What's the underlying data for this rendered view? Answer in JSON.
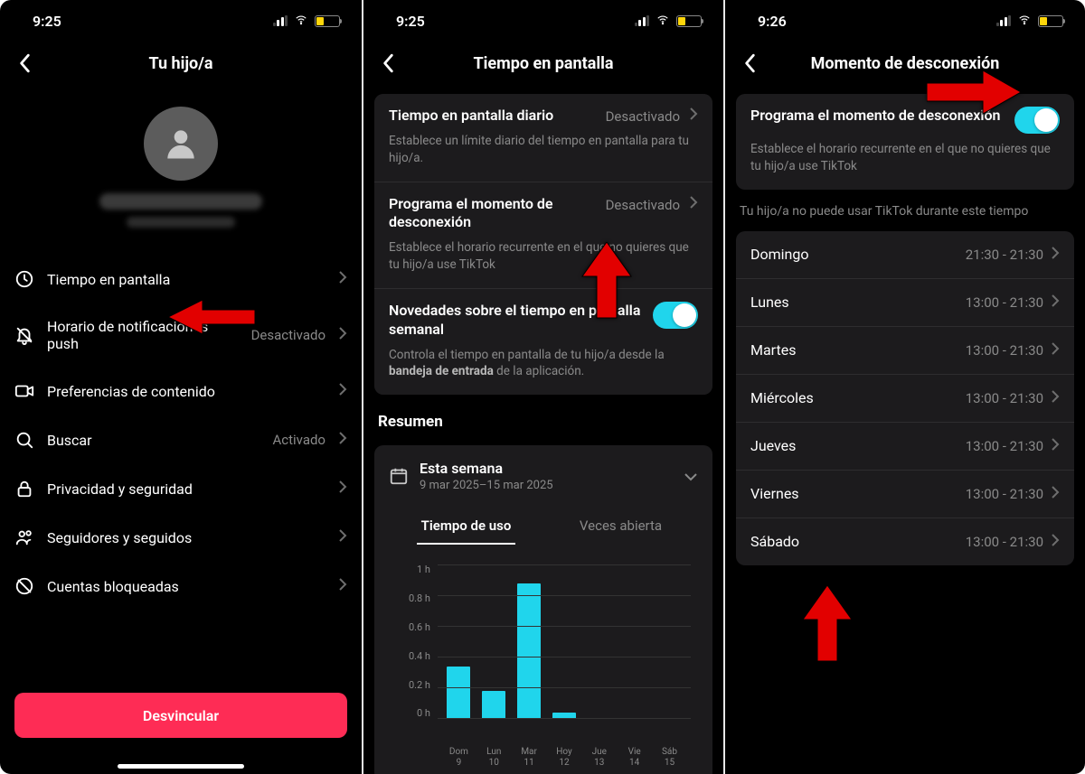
{
  "status": {
    "time1": "9:25",
    "time2": "9:25",
    "time3": "9:26"
  },
  "screen1": {
    "title": "Tu hijo/a",
    "settings": [
      {
        "icon": "clock",
        "label": "Tiempo en pantalla",
        "status": ""
      },
      {
        "icon": "bell-off",
        "label": "Horario de notificaciones push",
        "status": "Desactivado"
      },
      {
        "icon": "video",
        "label": "Preferencias de contenido",
        "status": ""
      },
      {
        "icon": "search",
        "label": "Buscar",
        "status": "Activado"
      },
      {
        "icon": "lock",
        "label": "Privacidad y seguridad",
        "status": ""
      },
      {
        "icon": "people",
        "label": "Seguidores y seguidos",
        "status": ""
      },
      {
        "icon": "ban",
        "label": "Cuentas bloqueadas",
        "status": ""
      }
    ],
    "unlink": "Desvincular"
  },
  "screen2": {
    "title": "Tiempo en pantalla",
    "cards": [
      {
        "title": "Tiempo en pantalla diario",
        "status": "Desactivado",
        "desc": "Establece un límite diario del tiempo en pantalla para tu hijo/a."
      },
      {
        "title": "Programa el momento de desconexión",
        "status": "Desactivado",
        "desc": "Establece el horario recurrente en el que no quieres que tu hijo/a use TikTok"
      },
      {
        "title": "Novedades sobre el tiempo en pantalla semanal",
        "toggle": true,
        "desc_pre": "Controla el tiempo en pantalla de tu hijo/a desde la ",
        "desc_bold": "bandeja de entrada",
        "desc_post": " de la aplicación."
      }
    ],
    "summary_header": "Resumen",
    "week_label": "Esta semana",
    "week_range": "9 mar 2025–15 mar 2025",
    "tab_usage": "Tiempo de uso",
    "tab_opened": "Veces abierta"
  },
  "screen3": {
    "title": "Momento de desconexión",
    "main_card": {
      "title": "Programa el momento de desconexión",
      "desc": "Establece el horario recurrente en el que no quieres que tu hijo/a use TikTok"
    },
    "info": "Tu hijo/a no puede usar TikTok durante este tiempo",
    "days": [
      {
        "day": "Domingo",
        "time": "21:30 - 21:30"
      },
      {
        "day": "Lunes",
        "time": "13:00 - 21:30"
      },
      {
        "day": "Martes",
        "time": "13:00 - 21:30"
      },
      {
        "day": "Miércoles",
        "time": "13:00 - 21:30"
      },
      {
        "day": "Jueves",
        "time": "13:00 - 21:30"
      },
      {
        "day": "Viernes",
        "time": "13:00 - 21:30"
      },
      {
        "day": "Sábado",
        "time": "13:00 - 21:30"
      }
    ]
  },
  "chart_data": {
    "type": "bar",
    "title": "Tiempo de uso",
    "ylabel": "horas",
    "ylim": [
      0,
      1
    ],
    "y_ticks": [
      "1 h",
      "0.8 h",
      "0.6 h",
      "0.4 h",
      "0.2 h",
      "0 h"
    ],
    "categories": [
      "Dom 9",
      "Lun 10",
      "Mar 11",
      "Hoy 12",
      "Jue 13",
      "Vie 14",
      "Sáb 15"
    ],
    "values": [
      0.34,
      0.18,
      0.88,
      0.04,
      0,
      0,
      0
    ]
  }
}
